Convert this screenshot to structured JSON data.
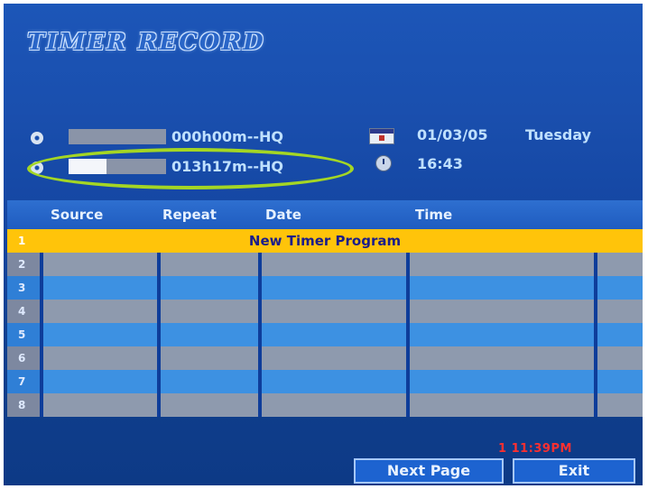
{
  "header": {
    "title": "Timer Record"
  },
  "status": {
    "disc1_remaining": "000h00m--HQ",
    "disc2_remaining": "013h17m--HQ",
    "date": "01/03/05",
    "weekday": "Tuesday",
    "time": "16:43"
  },
  "table": {
    "headers": [
      "Source",
      "Repeat",
      "Date",
      "Time"
    ],
    "rows": [
      {
        "num": "1",
        "label": "New Timer Program"
      },
      {
        "num": "2"
      },
      {
        "num": "3"
      },
      {
        "num": "4"
      },
      {
        "num": "5"
      },
      {
        "num": "6"
      },
      {
        "num": "7"
      },
      {
        "num": "8"
      }
    ]
  },
  "footer": {
    "next_page": "Next Page",
    "exit": "Exit",
    "recorder_clock": "1 11:39PM"
  },
  "colors": {
    "background": "#1a4fae",
    "highlight_row": "#ffc40a",
    "annotation_ellipse": "#a4d624",
    "clock_text": "#ff3030"
  }
}
